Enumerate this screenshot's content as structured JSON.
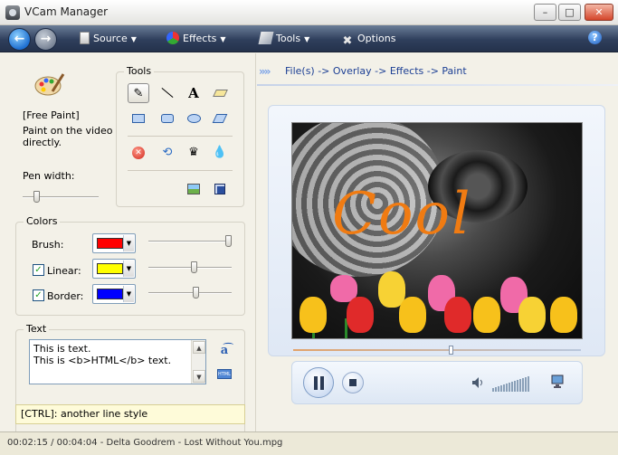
{
  "window": {
    "title": "VCam Manager"
  },
  "toolbar": {
    "menu": [
      {
        "label": "Source",
        "icon": "source-icon"
      },
      {
        "label": "Effects",
        "icon": "effects-icon"
      },
      {
        "label": "Tools",
        "icon": "tools-icon"
      },
      {
        "label": "Options",
        "icon": "options-icon"
      }
    ]
  },
  "left": {
    "tool_name": "[Free Paint]",
    "tool_desc": "Paint on the video directly.",
    "pen_width_label": "Pen width:",
    "pen_width": 0.15,
    "tools_title": "Tools",
    "colors_title": "Colors",
    "colors": {
      "brush": {
        "label": "Brush:",
        "color": "#ff0000",
        "level": 1.0
      },
      "linear": {
        "label": "Linear:",
        "color": "#ffff00",
        "checked": true,
        "level": 0.55
      },
      "border": {
        "label": "Border:",
        "color": "#0000ff",
        "checked": true,
        "level": 0.58
      }
    },
    "text_title": "Text",
    "text_line1": "This is text.",
    "text_line2": "This is <b>HTML</b> text.",
    "hint": "[CTRL]: another line style"
  },
  "right": {
    "breadcrumb_chevrons": "»»",
    "breadcrumb": "File(s) -> Overlay -> Effects -> Paint",
    "overlay_text": "Cool",
    "playback_progress": 0.55
  },
  "status": {
    "text": "00:02:15 / 00:04:04 - Delta Goodrem - Lost Without You.mpg"
  }
}
